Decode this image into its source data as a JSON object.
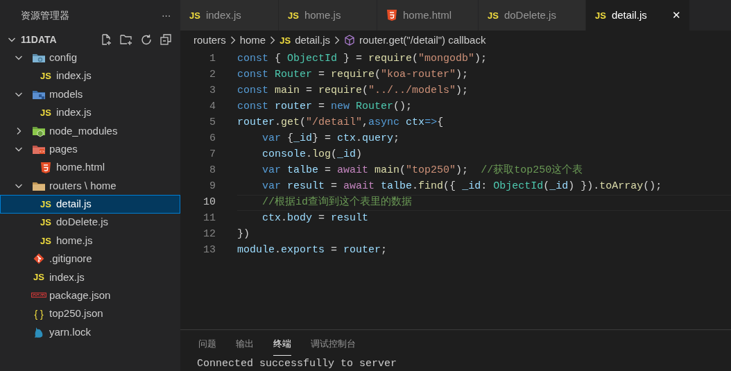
{
  "explorer": {
    "title": "资源管理器",
    "more": "···",
    "root": {
      "label": "11DATA",
      "expanded": true
    },
    "items": [
      {
        "label": "config",
        "kind": "folder-config",
        "expanded": true,
        "selected": false,
        "children": [
          {
            "label": "index.js",
            "kind": "js",
            "glyph": "JS",
            "selected": false
          }
        ]
      },
      {
        "label": "models",
        "kind": "folder-models",
        "expanded": true,
        "selected": false,
        "children": [
          {
            "label": "index.js",
            "kind": "js",
            "glyph": "JS",
            "selected": false
          }
        ]
      },
      {
        "label": "node_modules",
        "kind": "folder-node",
        "expanded": false,
        "selected": false
      },
      {
        "label": "pages",
        "kind": "folder-pages",
        "expanded": true,
        "selected": false,
        "children": [
          {
            "label": "home.html",
            "kind": "html",
            "selected": false
          }
        ]
      },
      {
        "label": "routers \\ home",
        "kind": "folder",
        "expanded": true,
        "selected": false,
        "children": [
          {
            "label": "detail.js",
            "kind": "js",
            "glyph": "JS",
            "selected": true
          },
          {
            "label": "doDelete.js",
            "kind": "js",
            "glyph": "JS",
            "selected": false
          },
          {
            "label": "home.js",
            "kind": "js",
            "glyph": "JS",
            "selected": false
          }
        ]
      },
      {
        "label": ".gitignore",
        "kind": "git",
        "selected": false
      },
      {
        "label": "index.js",
        "kind": "js",
        "glyph": "JS",
        "selected": false
      },
      {
        "label": "package.json",
        "kind": "npm",
        "selected": false
      },
      {
        "label": "top250.json",
        "kind": "json",
        "glyph": "{ }",
        "selected": false
      },
      {
        "label": "yarn.lock",
        "kind": "yarn",
        "selected": false
      }
    ]
  },
  "tabs": [
    {
      "label": "index.js",
      "kind": "js",
      "glyph": "JS",
      "selected": false
    },
    {
      "label": "home.js",
      "kind": "js",
      "glyph": "JS",
      "selected": false
    },
    {
      "label": "home.html",
      "kind": "html",
      "selected": false
    },
    {
      "label": "doDelete.js",
      "kind": "js",
      "glyph": "JS",
      "selected": false
    },
    {
      "label": "detail.js",
      "kind": "js",
      "glyph": "JS",
      "selected": true,
      "close": "✕"
    }
  ],
  "breadcrumb": [
    {
      "label": "routers",
      "kind": "text"
    },
    {
      "label": "home",
      "kind": "text"
    },
    {
      "label": "detail.js",
      "kind": "js",
      "glyph": "JS"
    },
    {
      "label": "router.get(\"/detail\") callback",
      "kind": "symbol"
    }
  ],
  "editor": {
    "lines": [
      {
        "number": "1",
        "current": false,
        "tokens": [
          {
            "text": "const",
            "kind": "keyword"
          },
          {
            "text": " { ",
            "kind": "plain"
          },
          {
            "text": "ObjectId",
            "kind": "class"
          },
          {
            "text": " } = ",
            "kind": "plain"
          },
          {
            "text": "require",
            "kind": "func"
          },
          {
            "text": "(",
            "kind": "plain"
          },
          {
            "text": "\"mongodb\"",
            "kind": "string"
          },
          {
            "text": ");",
            "kind": "plain"
          }
        ]
      },
      {
        "number": "2",
        "current": false,
        "tokens": [
          {
            "text": "const ",
            "kind": "keyword"
          },
          {
            "text": "Router",
            "kind": "class"
          },
          {
            "text": " = ",
            "kind": "plain"
          },
          {
            "text": "require",
            "kind": "func"
          },
          {
            "text": "(",
            "kind": "plain"
          },
          {
            "text": "\"koa-router\"",
            "kind": "string"
          },
          {
            "text": ");",
            "kind": "plain"
          }
        ]
      },
      {
        "number": "3",
        "current": false,
        "tokens": [
          {
            "text": "const ",
            "kind": "keyword"
          },
          {
            "text": "main",
            "kind": "func"
          },
          {
            "text": " = ",
            "kind": "plain"
          },
          {
            "text": "require",
            "kind": "func"
          },
          {
            "text": "(",
            "kind": "plain"
          },
          {
            "text": "\"../../models\"",
            "kind": "string"
          },
          {
            "text": ");",
            "kind": "plain"
          }
        ]
      },
      {
        "number": "4",
        "current": false,
        "tokens": [
          {
            "text": "const ",
            "kind": "keyword"
          },
          {
            "text": "router",
            "kind": "var"
          },
          {
            "text": " = ",
            "kind": "plain"
          },
          {
            "text": "new ",
            "kind": "keyword"
          },
          {
            "text": "Router",
            "kind": "class"
          },
          {
            "text": "();",
            "kind": "plain"
          }
        ]
      },
      {
        "number": "5",
        "current": false,
        "tokens": [
          {
            "text": "router",
            "kind": "var"
          },
          {
            "text": ".",
            "kind": "plain"
          },
          {
            "text": "get",
            "kind": "func"
          },
          {
            "text": "(",
            "kind": "plain"
          },
          {
            "text": "\"/detail\"",
            "kind": "string"
          },
          {
            "text": ",",
            "kind": "plain"
          },
          {
            "text": "async ",
            "kind": "keyword"
          },
          {
            "text": "ctx",
            "kind": "var"
          },
          {
            "text": "=>",
            "kind": "keyword"
          },
          {
            "text": "{",
            "kind": "plain"
          }
        ]
      },
      {
        "number": "6",
        "current": false,
        "tokens": [
          {
            "text": "    var",
            "kind": "keyword"
          },
          {
            "text": " {",
            "kind": "plain"
          },
          {
            "text": "_id",
            "kind": "var"
          },
          {
            "text": "} = ",
            "kind": "plain"
          },
          {
            "text": "ctx",
            "kind": "var"
          },
          {
            "text": ".",
            "kind": "plain"
          },
          {
            "text": "query",
            "kind": "var"
          },
          {
            "text": ";",
            "kind": "plain"
          }
        ]
      },
      {
        "number": "7",
        "current": false,
        "tokens": [
          {
            "text": "    console",
            "kind": "var"
          },
          {
            "text": ".",
            "kind": "plain"
          },
          {
            "text": "log",
            "kind": "func"
          },
          {
            "text": "(",
            "kind": "plain"
          },
          {
            "text": "_id",
            "kind": "var"
          },
          {
            "text": ")",
            "kind": "plain"
          }
        ]
      },
      {
        "number": "8",
        "current": false,
        "tokens": [
          {
            "text": "    var ",
            "kind": "keyword"
          },
          {
            "text": "talbe",
            "kind": "var"
          },
          {
            "text": " = ",
            "kind": "plain"
          },
          {
            "text": "await ",
            "kind": "control"
          },
          {
            "text": "main",
            "kind": "func"
          },
          {
            "text": "(",
            "kind": "plain"
          },
          {
            "text": "\"top250\"",
            "kind": "string"
          },
          {
            "text": ");  ",
            "kind": "plain"
          },
          {
            "text": "//获取top250这个表",
            "kind": "comment"
          }
        ]
      },
      {
        "number": "9",
        "current": false,
        "tokens": [
          {
            "text": "    var ",
            "kind": "keyword"
          },
          {
            "text": "result",
            "kind": "var"
          },
          {
            "text": " = ",
            "kind": "plain"
          },
          {
            "text": "await ",
            "kind": "control"
          },
          {
            "text": "talbe",
            "kind": "var"
          },
          {
            "text": ".",
            "kind": "plain"
          },
          {
            "text": "find",
            "kind": "func"
          },
          {
            "text": "({ ",
            "kind": "plain"
          },
          {
            "text": "_id",
            "kind": "var"
          },
          {
            "text": ": ",
            "kind": "plain"
          },
          {
            "text": "ObjectId",
            "kind": "class"
          },
          {
            "text": "(",
            "kind": "plain"
          },
          {
            "text": "_id",
            "kind": "var"
          },
          {
            "text": ") }).",
            "kind": "plain"
          },
          {
            "text": "toArray",
            "kind": "func"
          },
          {
            "text": "();",
            "kind": "plain"
          }
        ]
      },
      {
        "number": "10",
        "current": true,
        "tokens": [
          {
            "text": "    //根据id查询到这个表里的数据",
            "kind": "comment"
          }
        ]
      },
      {
        "number": "11",
        "current": false,
        "tokens": [
          {
            "text": "    ctx",
            "kind": "var"
          },
          {
            "text": ".",
            "kind": "plain"
          },
          {
            "text": "body",
            "kind": "var"
          },
          {
            "text": " = ",
            "kind": "plain"
          },
          {
            "text": "result",
            "kind": "var"
          }
        ]
      },
      {
        "number": "12",
        "current": false,
        "tokens": [
          {
            "text": "})",
            "kind": "plain"
          }
        ]
      },
      {
        "number": "13",
        "current": false,
        "tokens": [
          {
            "text": "module",
            "kind": "var"
          },
          {
            "text": ".",
            "kind": "plain"
          },
          {
            "text": "exports",
            "kind": "var"
          },
          {
            "text": " = ",
            "kind": "plain"
          },
          {
            "text": "router",
            "kind": "var"
          },
          {
            "text": ";",
            "kind": "plain"
          }
        ]
      }
    ]
  },
  "panel": {
    "tabs": [
      {
        "label": "问题",
        "selected": false
      },
      {
        "label": "输出",
        "selected": false
      },
      {
        "label": "终端",
        "selected": true
      },
      {
        "label": "调试控制台",
        "selected": false
      }
    ],
    "terminal": "Connected successfully to server"
  }
}
